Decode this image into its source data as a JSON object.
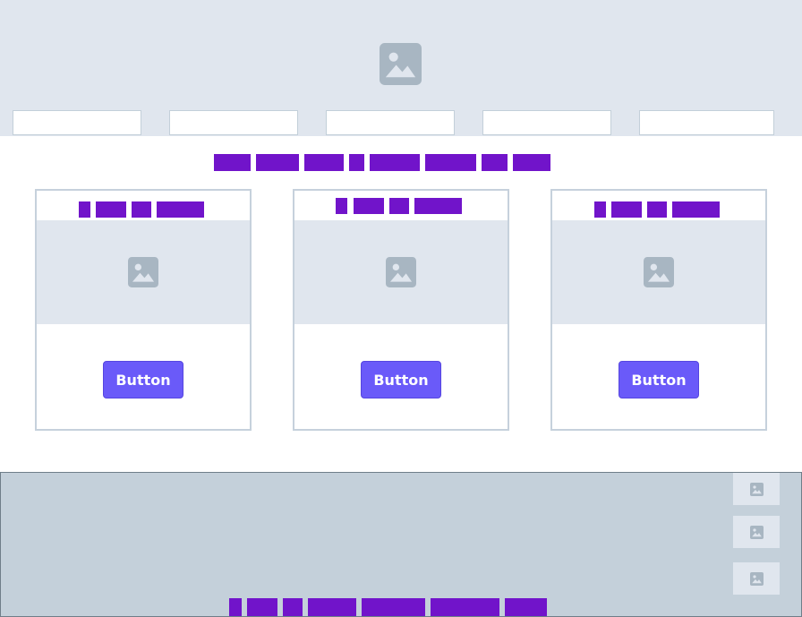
{
  "colors": {
    "hero_background": "#e0e6ee",
    "card_border": "#c6d1dc",
    "placeholder_text": "#7114ca",
    "button_primary": "#6a5af9",
    "footer_background": "#c4d0da"
  },
  "hero": {
    "icon": "image-placeholder-icon",
    "fields": [
      "",
      "",
      "",
      "",
      ""
    ]
  },
  "cards": [
    {
      "icon": "image-placeholder-icon",
      "button_label": "Button"
    },
    {
      "icon": "image-placeholder-icon",
      "button_label": "Button"
    },
    {
      "icon": "image-placeholder-icon",
      "button_label": "Button"
    }
  ],
  "footer": {
    "thumbnails": [
      "image-placeholder-icon",
      "image-placeholder-icon",
      "image-placeholder-icon"
    ]
  }
}
